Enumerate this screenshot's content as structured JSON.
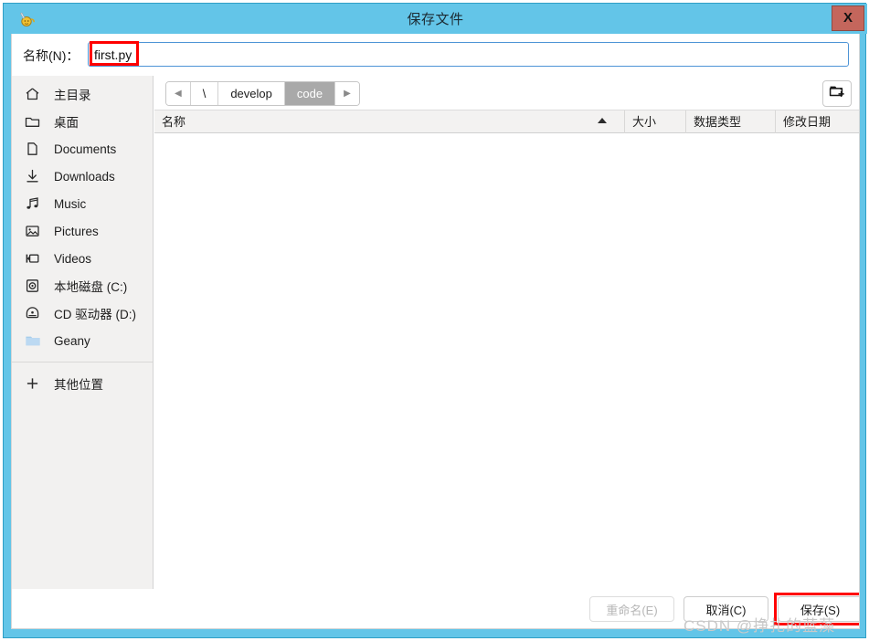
{
  "window": {
    "title": "保存文件",
    "icon": "geany-app-icon",
    "close_label": "X",
    "accent_color": "#63c5e8",
    "close_button_color": "#c4665c"
  },
  "name_field": {
    "label": "名称(N)：",
    "value": "first.py",
    "placeholder": "",
    "highlight_color": "#ff0000"
  },
  "sidebar": {
    "items": [
      {
        "label": "主目录",
        "icon": "home-icon"
      },
      {
        "label": "桌面",
        "icon": "folder-icon"
      },
      {
        "label": "Documents",
        "icon": "document-icon"
      },
      {
        "label": "Downloads",
        "icon": "download-icon"
      },
      {
        "label": "Music",
        "icon": "music-note-icon"
      },
      {
        "label": "Pictures",
        "icon": "picture-icon"
      },
      {
        "label": "Videos",
        "icon": "video-icon"
      },
      {
        "label": "本地磁盘 (C:)",
        "icon": "hard-drive-icon"
      },
      {
        "label": "CD 驱动器 (D:)",
        "icon": "optical-drive-icon"
      },
      {
        "label": "Geany",
        "icon": "blue-folder-icon"
      }
    ],
    "other_locations": {
      "label": "其他位置",
      "icon": "plus-icon"
    }
  },
  "pathbar": {
    "back_arrow": "◀",
    "forward_arrow": "▶",
    "crumbs": [
      {
        "label": "\\",
        "active": false
      },
      {
        "label": "develop",
        "active": false
      },
      {
        "label": "code",
        "active": true
      }
    ],
    "new_folder_icon": "new-folder-icon"
  },
  "file_list": {
    "columns": [
      {
        "label": "名称",
        "sorted": true,
        "sort_direction": "asc"
      },
      {
        "label": "大小",
        "sorted": false,
        "sort_direction": ""
      },
      {
        "label": "数据类型",
        "sorted": false,
        "sort_direction": ""
      },
      {
        "label": "修改日期",
        "sorted": false,
        "sort_direction": ""
      }
    ],
    "rows": []
  },
  "footer": {
    "rename_label": "重命名(E)",
    "rename_disabled": true,
    "cancel_label": "取消(C)",
    "save_label": "保存(S)",
    "save_highlight_color": "#ff0000"
  },
  "watermark": {
    "text": "CSDN @挣扎的蓝藻"
  }
}
